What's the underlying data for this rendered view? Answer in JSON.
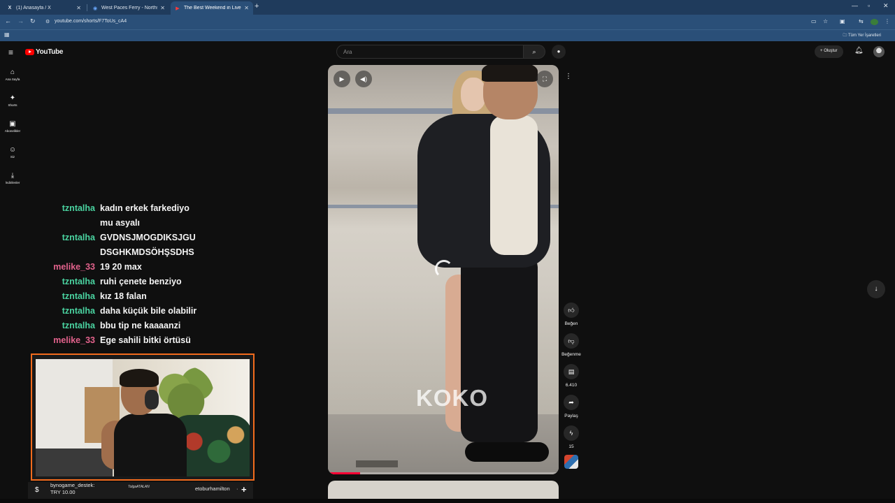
{
  "browser": {
    "tabs": [
      {
        "icon": "X",
        "title": "(1) Anasayfa / X",
        "active": false
      },
      {
        "icon": "◉",
        "title": "West Paces Ferry - Northside At...",
        "active": false
      },
      {
        "icon": "▶",
        "title": "The Best Weekend in Liverpool...",
        "active": true
      }
    ],
    "url": "youtube.com/shorts/F7ToUs_cA4",
    "bookmarks_all": "Tüm Yer İşaretleri"
  },
  "youtube": {
    "logo": "YouTube",
    "search_placeholder": "Ara",
    "create_label": "Oluştur",
    "guide": [
      {
        "icon": "home-icon",
        "glyph": "⌂",
        "label": "Ana Sayfa"
      },
      {
        "icon": "shorts-icon",
        "glyph": "✦",
        "label": "Shorts"
      },
      {
        "icon": "subscriptions-icon",
        "glyph": "▣",
        "label": "Abonelikler"
      },
      {
        "icon": "you-icon",
        "glyph": "☺",
        "label": "Siz"
      },
      {
        "icon": "downloads-icon",
        "glyph": "⤓",
        "label": "İndirilenler"
      }
    ],
    "actions": {
      "like_label": "Beğen",
      "dislike_label": "Beğenme",
      "comments_count": "6.410",
      "share_label": "Paylaş",
      "remix_count": "15"
    },
    "video": {
      "watermark": "KOKO",
      "progress_fraction": 0.14
    }
  },
  "stream": {
    "chat": [
      {
        "user": "tzntalha",
        "color": "green",
        "lines": [
          "kadın erkek farkediyo",
          "mu asyalı"
        ]
      },
      {
        "user": "tzntalha",
        "color": "green",
        "lines": [
          "GVDNSJMOGDIKSJGU",
          "DSGHKMDSÖHŞSDHS"
        ]
      },
      {
        "user": "melike_33",
        "color": "pink",
        "lines": [
          "19 20 max"
        ]
      },
      {
        "user": "tzntalha",
        "color": "green",
        "lines": [
          "ruhi çenete benziyo"
        ]
      },
      {
        "user": "tzntalha",
        "color": "green",
        "lines": [
          "kız 18 falan"
        ]
      },
      {
        "user": "tzntalha",
        "color": "green",
        "lines": [
          "daha küçük bile olabilir"
        ]
      },
      {
        "user": "tzntalha",
        "color": "green",
        "lines": [
          "bbu tip ne kaaaanzi"
        ]
      },
      {
        "user": "melike_33",
        "color": "pink",
        "lines": [
          "Ege sahili bitki örtüsü"
        ]
      }
    ],
    "ticker": {
      "donor": "bynogame_destek:",
      "amount": "TRY 10.00",
      "logo": "TolgaATALAN",
      "name": "etoburhamilton",
      "sep": "·"
    }
  }
}
